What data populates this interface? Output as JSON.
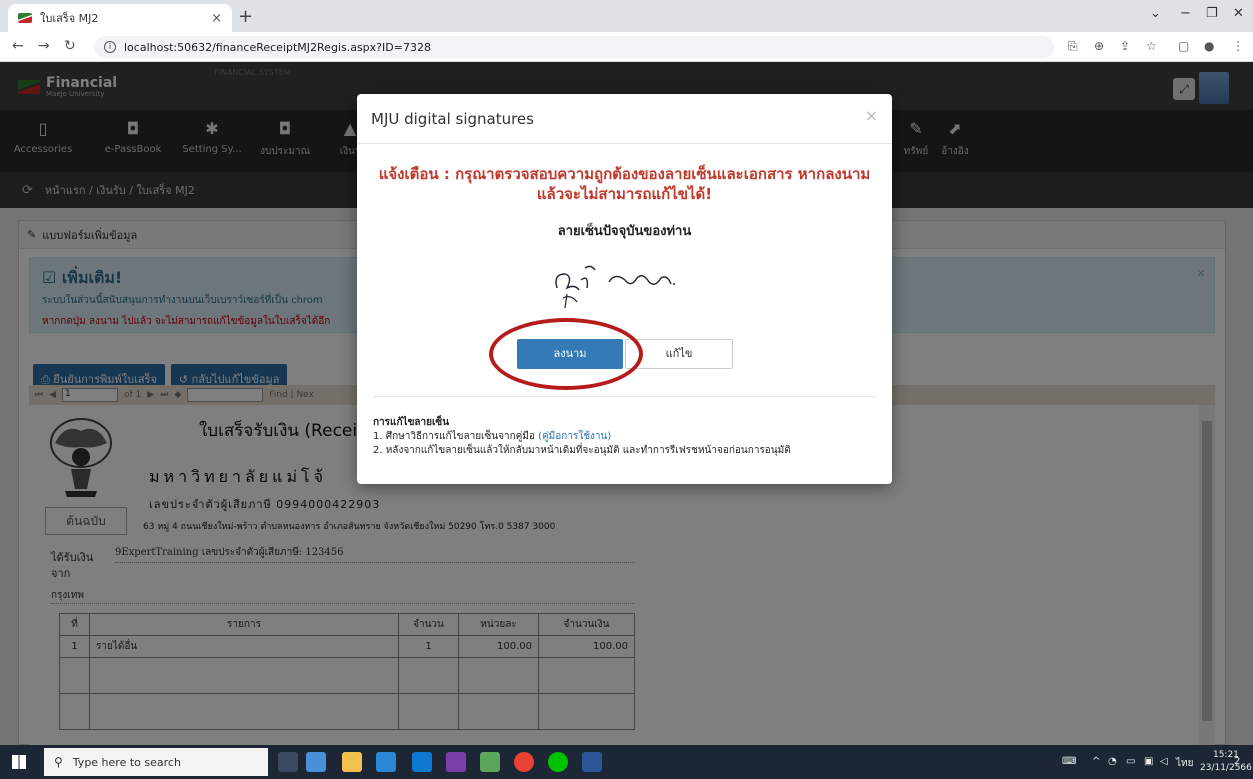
{
  "browser": {
    "tab_title": "ใบเสร็จ MJ2",
    "url": "localhost:50632/financeReceiptMJ2Regis.aspx?ID=7328"
  },
  "app": {
    "logo_title": "Financial",
    "logo_sub": "Maejo University",
    "system_name": "FINANCIAL SYSTEM",
    "menu": [
      "Accessories",
      "e-PassBook",
      "Setting Sy...",
      "งบประมาณ",
      "เงินรั",
      "ทรัพย์",
      "อ้างอิง"
    ],
    "breadcrumb": "หน้าแรก / เงินรับ / ใบเสร็จ MJ2"
  },
  "form": {
    "panel_title": "แบบฟอร์มเพิ่มข้อมูล",
    "alert_title": "เพิ่มเติม!",
    "alert_line1": "ระบบในส่วนนี้สนับสนุนการทำงานบนเว็บเบราว์เซอร์ที่เป็น chrom",
    "alert_line2": "หากกดปุ่ม ลงนาม ไปแล้ว จะไม่สามารถแก้ไขข้อมูลในใบเสร็จได้อีก",
    "confirm_print": "ยืนยันการพิมพ์ใบเสร็จ",
    "back_edit": "กลับไปแก้ไขข้อมูล",
    "page_value": "1",
    "page_of": "of 1",
    "find_label": "Find | Nex"
  },
  "receipt": {
    "title": "ใบเสร็จรับเงิน (Receipt",
    "university": "มหาวิทยาลัยแม่โจ้",
    "taxid": "เลขประจำตัวผู้เสียภาษี  0994000422903",
    "original": "ต้นฉบับ",
    "address": "63  หมู่ 4 ถนนเชียงใหม่-พร้าว ตำบลหนองหาร อำเภอสันทราย จังหวัดเชียงใหม่ 50290 โทร.0 5387 3000",
    "received_label": "ได้รับเงิน",
    "from_label": "จาก",
    "payer": "9ExpertTraining  เลขประจำตัวผู้เสียภาษี: 123456",
    "city": "กรุงเทพ",
    "columns": [
      "ที่",
      "รายการ",
      "จำนวน",
      "หน่วยละ",
      "จำนวนเงิน"
    ],
    "rows": [
      [
        "1",
        "รายได้อื่น",
        "1",
        "100.00",
        "100.00"
      ]
    ]
  },
  "modal": {
    "title": "MJU digital signatures",
    "warning": "แจ้งเตือน : กรุณาตรวจสอบความถูกต้องของลายเซ็นและเอกสาร หากลงนามแล้วจะไม่สามารถแก้ไขได้!",
    "current_sig": "ลายเซ็นปัจจุบันของท่าน",
    "sign_button": "ลงนาม",
    "edit_button": "แก้ไข",
    "notes_title": "การแก้ไขลายเซ็น",
    "note1_prefix": "1. ศึกษาวิธีการแก้ไขลายเซ็นจากคู่มือ ",
    "note1_link": "(คู่มือการใช้งาน)",
    "note2": "2. หลังจากแก้ไขลายเซ็นแล้วให้กลับมาหน้าเดิมที่จะอนุมัติ และทำการรีเฟรชหน้าจอก่อนการอนุมัติ"
  },
  "taskbar": {
    "search_placeholder": "Type here to search",
    "lang": "ไทย",
    "time": "15:21",
    "date": "23/11/2566",
    "notif_count": "2"
  }
}
